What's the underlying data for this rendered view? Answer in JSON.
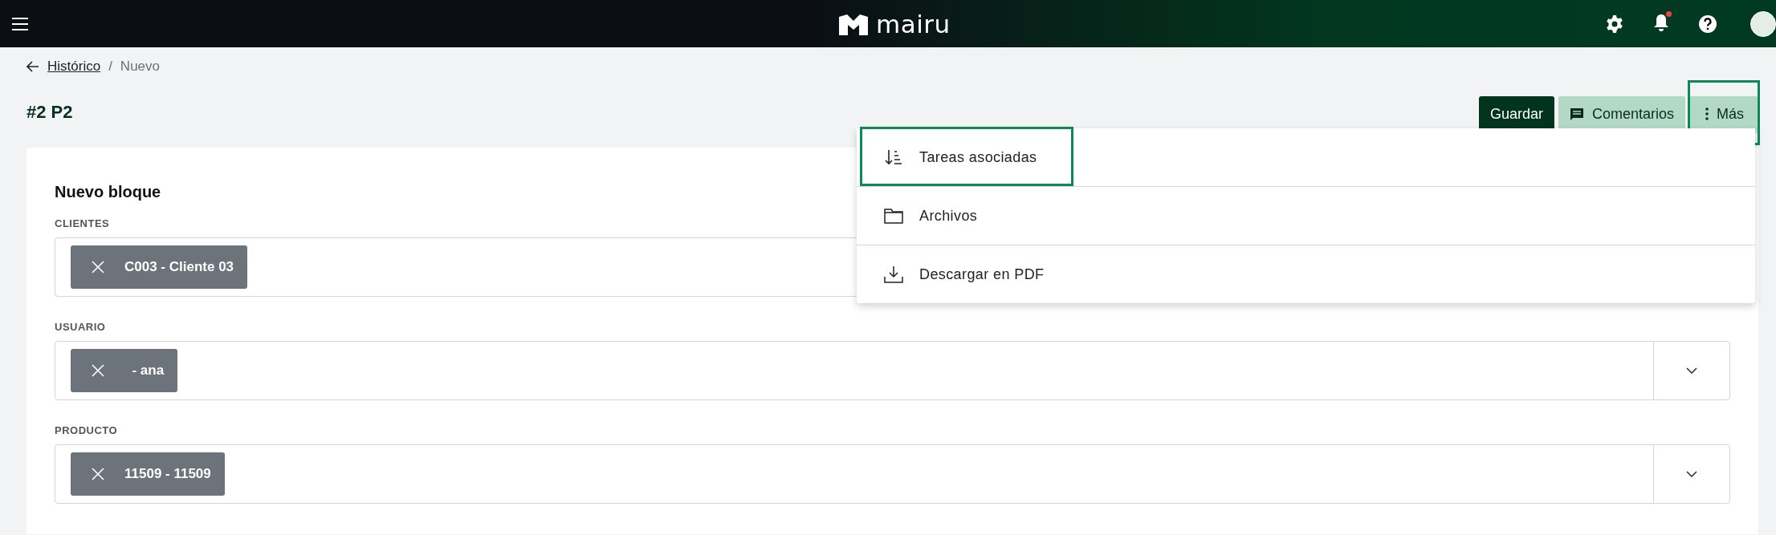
{
  "top_bar": {
    "logo": "mairu",
    "notifications_unread": true
  },
  "breadcrumb": {
    "link": "Histórico",
    "separator": "/",
    "current": "Nuevo"
  },
  "title": "#2 P2",
  "actions": [
    {
      "label": "Guardar",
      "kind": "primary",
      "highlighted": false
    },
    {
      "label": "Comentarios",
      "kind": "comments",
      "highlighted": false
    },
    {
      "label": "Más",
      "kind": "more",
      "highlighted": true
    }
  ],
  "menu": {
    "items": [
      {
        "label": "Tareas asociadas",
        "kind": "sort",
        "highlighted": true
      },
      {
        "label": "Archivos",
        "kind": "folder",
        "highlighted": false
      },
      {
        "label": "Descargar en PDF",
        "kind": "download",
        "highlighted": false
      }
    ]
  },
  "block": {
    "title": "Nuevo bloque",
    "fields": [
      {
        "label": "CLIENTES",
        "chips": [
          "C003 - Cliente 03"
        ]
      },
      {
        "label": "USUARIO",
        "chips": [
          "  - ana"
        ]
      },
      {
        "label": "PRODUCTO",
        "chips": [
          "11509 - 11509"
        ]
      }
    ]
  }
}
